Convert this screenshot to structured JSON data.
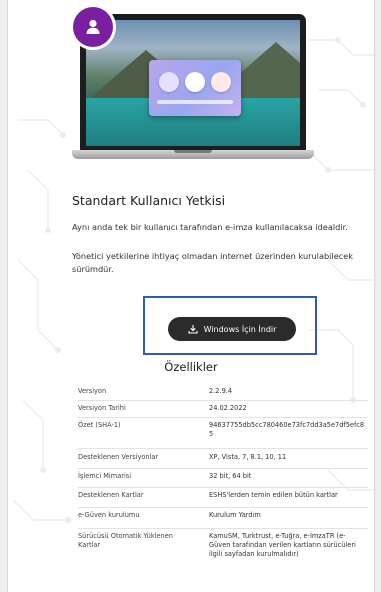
{
  "edition": {
    "title": "Standart Kullanıcı Yetkisi",
    "description_1": "Aynı anda tek bir kullanıcı tarafından e-imza kullanılacaksa idealdir.",
    "description_2": "Yönetici yetkilerine ihtiyaç olmadan internet üzerinden kurulabilecek sürümdür."
  },
  "download": {
    "label": "Windows İçin İndir",
    "icon": "download-icon"
  },
  "avatar_icon": "user-icon",
  "colors": {
    "avatar_bg": "#7b1fa2",
    "button_bg": "#2b2b2b",
    "highlight_border": "#2f5da8"
  },
  "features": {
    "title": "Özellikler",
    "rows": [
      {
        "key": "Versiyon",
        "value": "2.2.9.4"
      },
      {
        "key": "Versiyon Tarihi",
        "value": "24.02.2022"
      },
      {
        "key": "Özet (SHA-1)",
        "value": "94637755db5cc780460e73fc7dd3a5e7df5efc85"
      },
      {
        "key": "Desteklenen Versiyonlar",
        "value": "XP, Vista, 7, 8.1, 10, 11"
      },
      {
        "key": "İşlemci Mimarisi",
        "value": "32 bit, 64 bit"
      },
      {
        "key": "Desteklenen Kartlar",
        "value": "ESHS'lerden temin edilen bütün kartlar"
      },
      {
        "key": "e-Güven kurulumu",
        "value": "Kurulum Yardım"
      },
      {
        "key": "Sürücüsü Otomatik Yüklenen Kartlar",
        "value": "KamuSM, Turktrust, e-Tuğra, e-İmzaTR (e-Güven tarafından verilen kartların sürücüleri ilgili sayfadan kurulmalıdır)"
      }
    ]
  }
}
